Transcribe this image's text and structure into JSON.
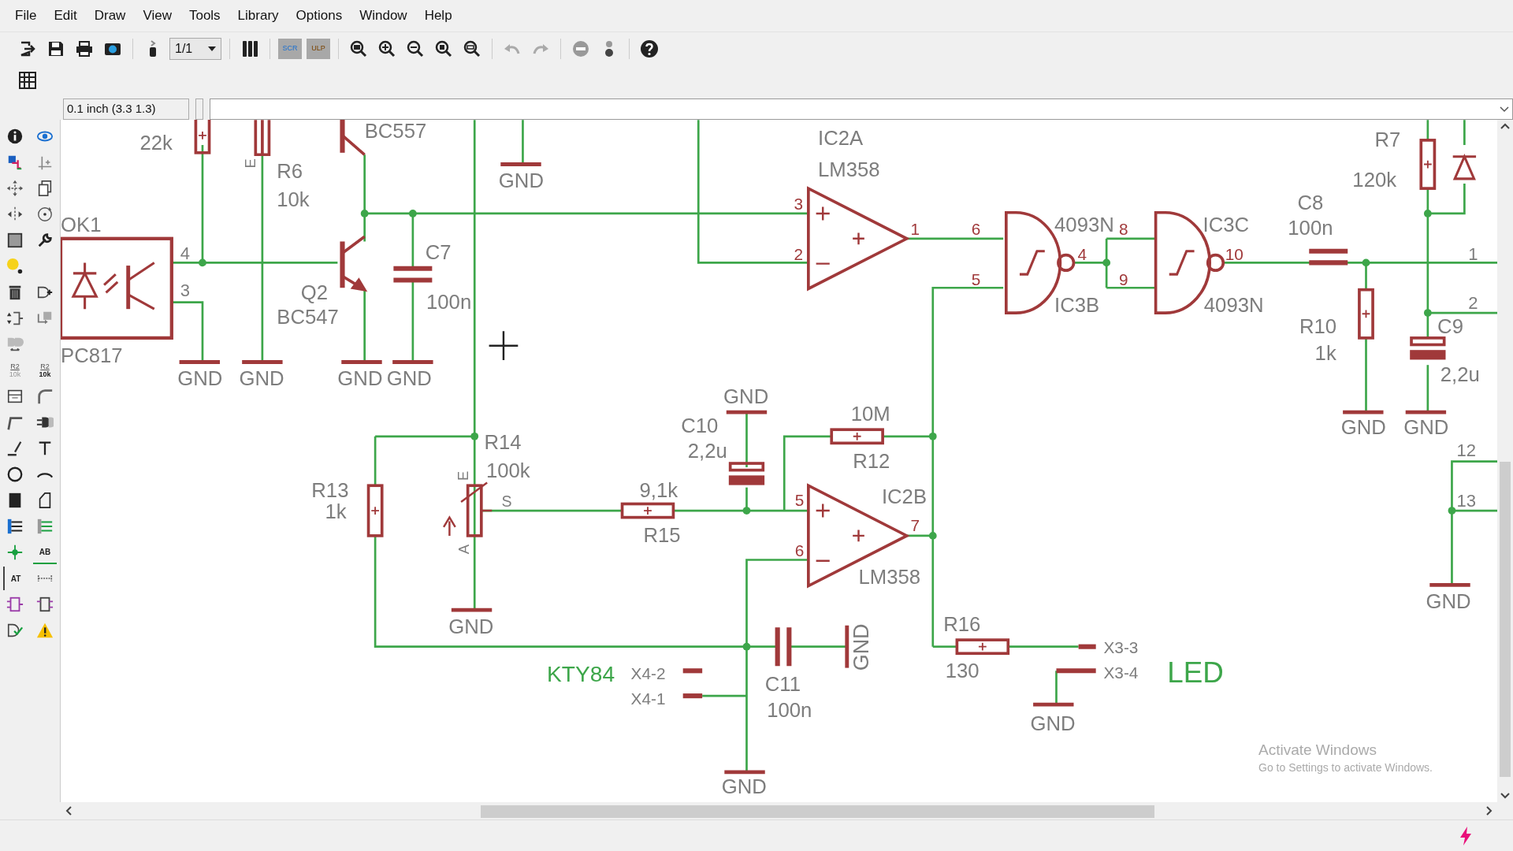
{
  "menu": [
    "File",
    "Edit",
    "Draw",
    "View",
    "Tools",
    "Library",
    "Options",
    "Window",
    "Help"
  ],
  "toolbar": {
    "sheet": "1/1",
    "script_label": "SCR",
    "ulp_label": "ULP"
  },
  "coordinates": "0.1 inch (3.3 1.3)",
  "palette": [
    {
      "kind": "info"
    },
    {
      "kind": "eye"
    },
    {
      "kind": "layers"
    },
    {
      "kind": "mark"
    },
    {
      "kind": "move"
    },
    {
      "kind": "copy"
    },
    {
      "kind": "mirror"
    },
    {
      "kind": "rotate"
    },
    {
      "kind": "group"
    },
    {
      "kind": "wrench"
    },
    {
      "kind": "dot"
    },
    {
      "kind": "blank"
    },
    {
      "kind": "trash"
    },
    {
      "kind": "add"
    },
    {
      "kind": "pinswap"
    },
    {
      "kind": "replace"
    },
    {
      "kind": "gateswap"
    },
    {
      "kind": "blank"
    },
    {
      "kind": "name",
      "text": "R2",
      "subtext": "10k"
    },
    {
      "kind": "value",
      "text": "R2",
      "subtext": "10k"
    },
    {
      "kind": "smash"
    },
    {
      "kind": "miter"
    },
    {
      "kind": "split"
    },
    {
      "kind": "invoke"
    },
    {
      "kind": "line"
    },
    {
      "kind": "text"
    },
    {
      "kind": "circle"
    },
    {
      "kind": "arc"
    },
    {
      "kind": "rect"
    },
    {
      "kind": "polygon"
    },
    {
      "kind": "bus"
    },
    {
      "kind": "net"
    },
    {
      "kind": "junction"
    },
    {
      "kind": "label",
      "text": "AB"
    },
    {
      "kind": "attribute",
      "text": "AT"
    },
    {
      "kind": "dimension"
    },
    {
      "kind": "frame"
    },
    {
      "kind": "module"
    },
    {
      "kind": "erc"
    },
    {
      "kind": "warning"
    }
  ],
  "schematic": {
    "labels": [
      {
        "text": "22k",
        "kind": "label"
      },
      {
        "text": "BC557",
        "kind": "label"
      },
      {
        "text": "E",
        "kind": "label"
      },
      {
        "text": "R6",
        "kind": "label"
      },
      {
        "text": "10k",
        "kind": "label"
      },
      {
        "text": "GND",
        "kind": "label"
      },
      {
        "text": "IC2A",
        "kind": "label"
      },
      {
        "text": "LM358",
        "kind": "label"
      },
      {
        "text": "OK1",
        "kind": "label"
      },
      {
        "text": "4",
        "kind": "label"
      },
      {
        "text": "3",
        "kind": "label"
      },
      {
        "text": "C7",
        "kind": "label"
      },
      {
        "text": "Q2",
        "kind": "label"
      },
      {
        "text": "BC547",
        "kind": "label"
      },
      {
        "text": "100n",
        "kind": "label"
      },
      {
        "text": "PC817",
        "kind": "label"
      },
      {
        "text": "GND",
        "kind": "label"
      },
      {
        "text": "GND",
        "kind": "label"
      },
      {
        "text": "GND",
        "kind": "label"
      },
      {
        "text": "GND",
        "kind": "label"
      },
      {
        "text": "3",
        "kind": "pin"
      },
      {
        "text": "2",
        "kind": "pin"
      },
      {
        "text": "1",
        "kind": "pin"
      },
      {
        "text": "6",
        "kind": "pin"
      },
      {
        "text": "5",
        "kind": "pin"
      },
      {
        "text": "4093N",
        "kind": "label"
      },
      {
        "text": "8",
        "kind": "pin"
      },
      {
        "text": "4",
        "kind": "pin"
      },
      {
        "text": "9",
        "kind": "pin"
      },
      {
        "text": "IC3C",
        "kind": "label"
      },
      {
        "text": "10",
        "kind": "pin"
      },
      {
        "text": "IC3B",
        "kind": "label"
      },
      {
        "text": "4093N",
        "kind": "label"
      },
      {
        "text": "R7",
        "kind": "label"
      },
      {
        "text": "120k",
        "kind": "label"
      },
      {
        "text": "C8",
        "kind": "label"
      },
      {
        "text": "100n",
        "kind": "label"
      },
      {
        "text": "1",
        "kind": "label"
      },
      {
        "text": "2",
        "kind": "label"
      },
      {
        "text": "R10",
        "kind": "label"
      },
      {
        "text": "1k",
        "kind": "label"
      },
      {
        "text": "C9",
        "kind": "label"
      },
      {
        "text": "2,2u",
        "kind": "label"
      },
      {
        "text": "GND",
        "kind": "label"
      },
      {
        "text": "GND",
        "kind": "label"
      },
      {
        "text": "GND",
        "kind": "label"
      },
      {
        "text": "C10",
        "kind": "label"
      },
      {
        "text": "2,2u",
        "kind": "label"
      },
      {
        "text": "10M",
        "kind": "label"
      },
      {
        "text": "R12",
        "kind": "label"
      },
      {
        "text": "R14",
        "kind": "label"
      },
      {
        "text": "100k",
        "kind": "label"
      },
      {
        "text": "E",
        "kind": "label"
      },
      {
        "text": "R13",
        "kind": "label"
      },
      {
        "text": "1k",
        "kind": "label"
      },
      {
        "text": "S",
        "kind": "label"
      },
      {
        "text": "9,1k",
        "kind": "label"
      },
      {
        "text": "R15",
        "kind": "label"
      },
      {
        "text": "5",
        "kind": "pin"
      },
      {
        "text": "IC2B",
        "kind": "label"
      },
      {
        "text": "7",
        "kind": "pin"
      },
      {
        "text": "6",
        "kind": "pin"
      },
      {
        "text": "A",
        "kind": "label"
      },
      {
        "text": "LM358",
        "kind": "label"
      },
      {
        "text": "12",
        "kind": "label"
      },
      {
        "text": "13",
        "kind": "label"
      },
      {
        "text": "GND",
        "kind": "label"
      },
      {
        "text": "GND",
        "kind": "label"
      },
      {
        "text": "R16",
        "kind": "label"
      },
      {
        "text": "130",
        "kind": "label"
      },
      {
        "text": "X3-3",
        "kind": "label"
      },
      {
        "text": "X3-4",
        "kind": "label"
      },
      {
        "text": "LED",
        "kind": "net"
      },
      {
        "text": "GND",
        "kind": "label"
      },
      {
        "text": "KTY84",
        "kind": "net"
      },
      {
        "text": "X4-2",
        "kind": "label"
      },
      {
        "text": "X4-1",
        "kind": "label"
      },
      {
        "text": "C11",
        "kind": "label"
      },
      {
        "text": "100n",
        "kind": "label"
      },
      {
        "text": "GND",
        "kind": "label"
      },
      {
        "text": "GND",
        "kind": "label"
      }
    ]
  },
  "activation": {
    "title": "Activate Windows",
    "message": "Go to Settings to activate Windows."
  }
}
